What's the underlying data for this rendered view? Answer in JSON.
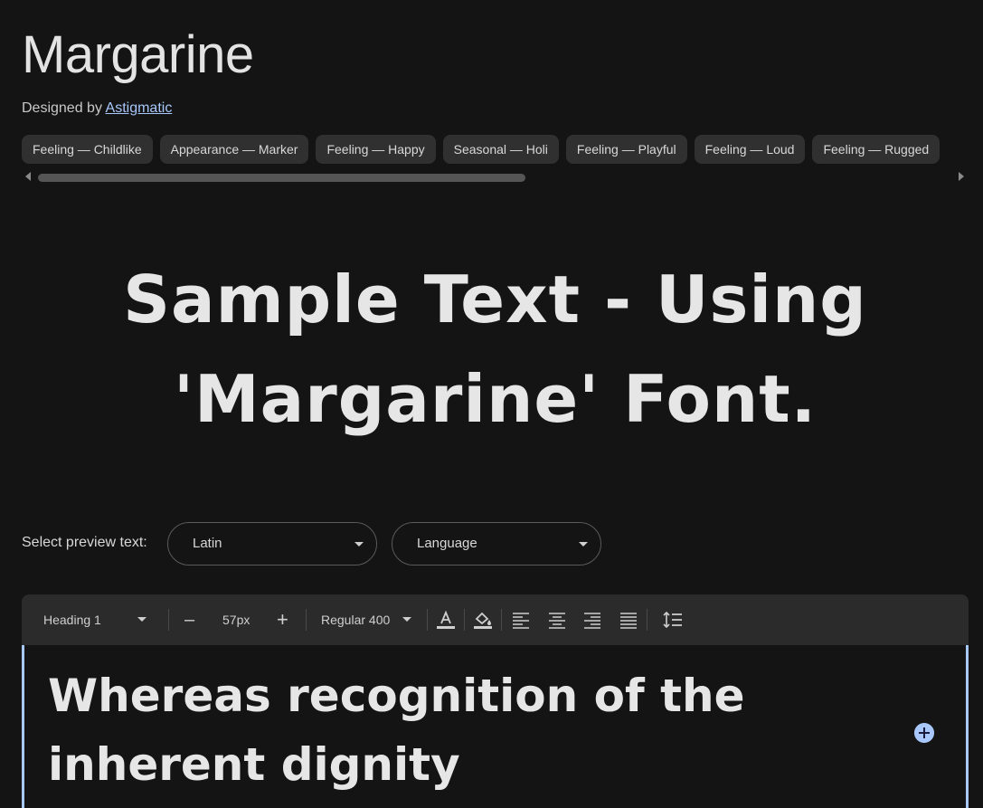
{
  "font": {
    "name": "Margarine",
    "designed_by_label": "Designed by",
    "designer": "Astigmatic"
  },
  "tags": [
    "Feeling — Childlike",
    "Appearance — Marker",
    "Feeling — Happy",
    "Seasonal — Holi",
    "Feeling — Playful",
    "Feeling — Loud",
    "Feeling — Rugged"
  ],
  "sample": {
    "line1": "Sample Text - Using",
    "line2": "'Margarine' Font."
  },
  "preview": {
    "label": "Select preview text:",
    "script_value": "Latin",
    "language_value": "Language"
  },
  "toolbar": {
    "style_value": "Heading 1",
    "decrease_label": "–",
    "size_value": "57px",
    "increase_label": "+",
    "weight_value": "Regular 400"
  },
  "editor": {
    "text": "Whereas recognition of the inherent dignity"
  },
  "colors": {
    "background": "#141414",
    "chip": "#303030",
    "toolbar": "#2b2b2b",
    "accent": "#a8c7fa"
  }
}
